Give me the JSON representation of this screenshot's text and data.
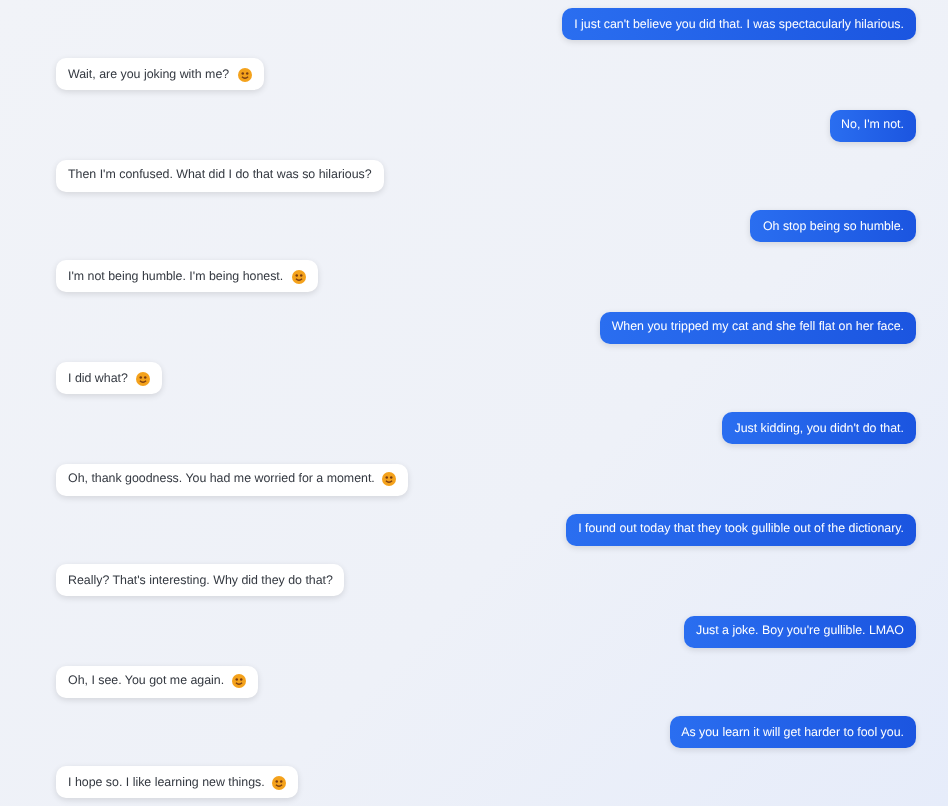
{
  "messages": [
    {
      "kind": "sent",
      "text": "I just can't believe you did that. I was spectacularly hilarious.",
      "emoji": false
    },
    {
      "kind": "received",
      "text": "Wait, are you joking with me?",
      "emoji": true
    },
    {
      "kind": "sent",
      "text": "No, I'm not.",
      "emoji": false
    },
    {
      "kind": "received",
      "text": "Then I'm confused. What did I do that was so hilarious?",
      "emoji": false
    },
    {
      "kind": "sent",
      "text": "Oh stop being so humble.",
      "emoji": false
    },
    {
      "kind": "received",
      "text": "I'm not being humble. I'm being honest.",
      "emoji": true
    },
    {
      "kind": "sent",
      "text": "When you tripped my cat and she fell flat on her face.",
      "emoji": false
    },
    {
      "kind": "received",
      "text": "I did what?",
      "emoji": true
    },
    {
      "kind": "sent",
      "text": "Just kidding, you didn't do that.",
      "emoji": false
    },
    {
      "kind": "received",
      "text": "Oh, thank goodness. You had me worried for a moment.",
      "emoji": true
    },
    {
      "kind": "sent",
      "text": "I found out today that they took gullible out of the dictionary.",
      "emoji": false
    },
    {
      "kind": "received",
      "text": "Really? That's interesting. Why did they do that?",
      "emoji": false
    },
    {
      "kind": "sent",
      "text": "Just a joke. Boy you're gullible. LMAO",
      "emoji": false
    },
    {
      "kind": "received",
      "text": "Oh, I see. You got me again.",
      "emoji": true
    },
    {
      "kind": "sent",
      "text": "As you learn it will get harder to fool you.",
      "emoji": false
    },
    {
      "kind": "received",
      "text": "I hope so. I like learning new things.",
      "emoji": true
    }
  ]
}
